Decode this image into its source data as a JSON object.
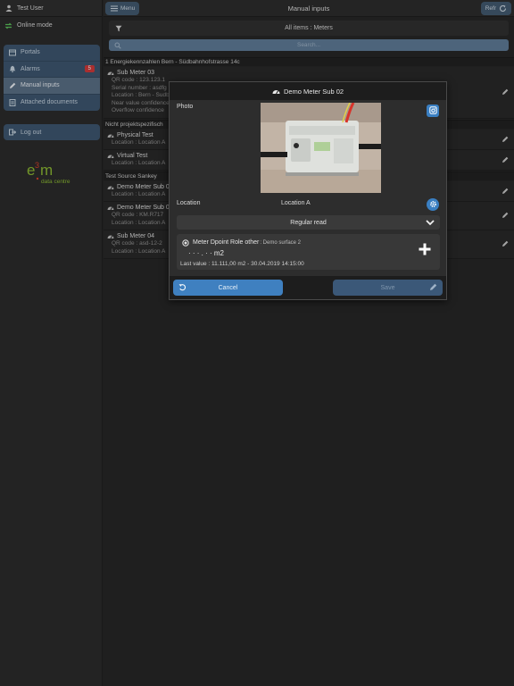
{
  "sidebar": {
    "user": "Test User",
    "mode": "Online mode",
    "items": [
      {
        "label": "Portals",
        "icon": "portal-icon"
      },
      {
        "label": "Alarms",
        "icon": "bell-icon",
        "badge": "5"
      },
      {
        "label": "Manual inputs",
        "icon": "pencil-icon"
      },
      {
        "label": "Attached documents",
        "icon": "document-icon"
      }
    ],
    "logout": "Log out",
    "logo_text": "data centre"
  },
  "topbar": {
    "menu_label": "Menu",
    "title": "Manual inputs",
    "refresh_label": "Refr"
  },
  "filter": {
    "label": "All items : Meters"
  },
  "search": {
    "placeholder": "Search..."
  },
  "groups": [
    {
      "header": "1 Energiekennzahlen Bern - Südbahnhofstrasse 14c"
    },
    {
      "header": "Nicht projektspezifisch"
    },
    {
      "header": "Test Source Sankey"
    }
  ],
  "items": [
    {
      "title": "Sub Meter 03",
      "lines": [
        "QR code : 123.123.1",
        "Serial number : asdfg",
        "Location : Bern - Sudb",
        "Near value confidence",
        "Overflow confidence"
      ]
    },
    {
      "title": "Physical Test",
      "lines": [
        "Location : Location A"
      ]
    },
    {
      "title": "Virtual Test",
      "lines": [
        "Location : Location A"
      ]
    },
    {
      "title": "Demo Meter Sub 0",
      "lines": [
        "Location : Location A"
      ]
    },
    {
      "title": "Demo Meter Sub 0",
      "lines": [
        "QR code : KM.R717",
        "Location : Location A"
      ]
    },
    {
      "title": "Sub Meter 04",
      "lines": [
        "QR code : asd-12-2",
        "Location : Location A"
      ]
    }
  ],
  "modal": {
    "title": "Demo Meter Sub 02",
    "photo_label": "Photo",
    "location_label": "Location",
    "location_value": "Location A",
    "read_type": "Regular read",
    "datapoint": {
      "role": "Meter Dpoint Role other",
      "surface": " : Demo surface 2",
      "value": "· · · . · · m2",
      "last_value": "Last value : 11.111,00 m2 - 30.04.2019 14:15:00"
    },
    "cancel_label": "Cancel",
    "save_label": "Save"
  },
  "colors": {
    "accent": "#3f80c0",
    "sidebar_menu": "#3e5670",
    "badge": "#d03a3a"
  }
}
